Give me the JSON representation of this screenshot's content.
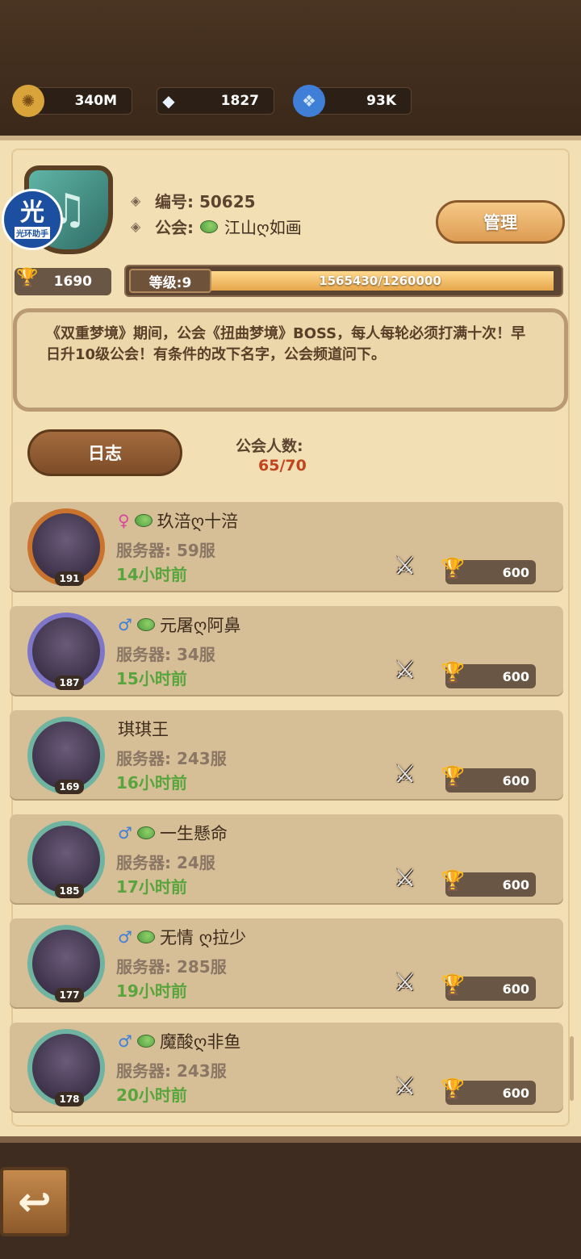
{
  "currencies": [
    {
      "name": "gold",
      "value": "340M",
      "icon": "coin-icon",
      "color": "#d9a43a"
    },
    {
      "name": "diamond",
      "value": "1827",
      "icon": "diamond-icon",
      "color": "#d7e7f6"
    },
    {
      "name": "crystal",
      "value": "93K",
      "icon": "blue-crystal-icon",
      "color": "#3f7fd8"
    }
  ],
  "guild": {
    "id_label": "编号: 50625",
    "name_prefix": "公会:",
    "name": "江山ღ如画",
    "manage_label": "管理",
    "trophies": "1690",
    "level_label": "等级:9",
    "exp_text": "1565430/1260000",
    "notice": "《双重梦境》期间，公会《扭曲梦境》BOSS，每人每轮必须打满十次！早日升10级公会！有条件的改下名字，公会频道问下。",
    "log_label": "日志",
    "member_count_label": "公会人数:",
    "member_count_value": "65/70"
  },
  "watermark": {
    "big": "光",
    "small": "光环助手"
  },
  "members": [
    {
      "gender": "♀",
      "gender_type": "female",
      "name": "玖涪ღ十涪",
      "server": "服务器: 59服",
      "time": "14小时前",
      "level": "191",
      "score": "600",
      "frame_color": "#c9732c"
    },
    {
      "gender": "♂",
      "gender_type": "male",
      "name": "元屠ღ阿鼻",
      "server": "服务器: 34服",
      "time": "15小时前",
      "level": "187",
      "score": "600",
      "frame_color": "#7e77c9"
    },
    {
      "gender": "",
      "gender_type": "none",
      "name": "琪琪王",
      "server": "服务器: 243服",
      "time": "16小时前",
      "level": "169",
      "score": "600",
      "frame_color": "#6fb3a1"
    },
    {
      "gender": "♂",
      "gender_type": "male",
      "name": "一生懸命",
      "server": "服务器: 24服",
      "time": "17小时前",
      "level": "185",
      "score": "600",
      "frame_color": "#6fb3a1"
    },
    {
      "gender": "♂",
      "gender_type": "male",
      "name": "无情 ღ拉少",
      "server": "服务器: 285服",
      "time": "19小时前",
      "level": "177",
      "score": "600",
      "frame_color": "#6fb3a1"
    },
    {
      "gender": "♂",
      "gender_type": "male",
      "name": "魔酸ღ非鱼",
      "server": "服务器: 243服",
      "time": "20小时前",
      "level": "178",
      "score": "600",
      "frame_color": "#6fb3a1"
    }
  ],
  "back_label": "↩"
}
